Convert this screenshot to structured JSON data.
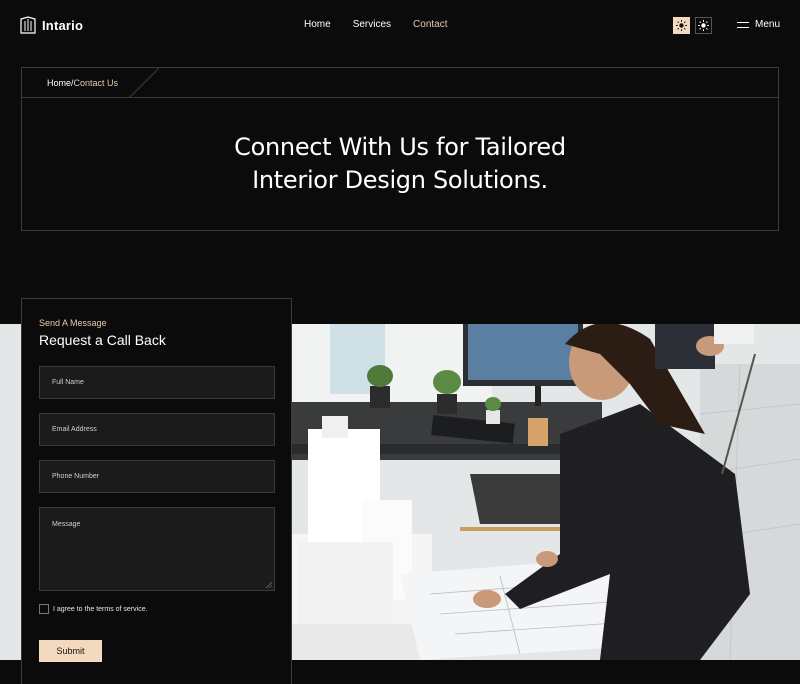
{
  "brand": {
    "name": "Intario",
    "logo_icon": "building-logo-icon"
  },
  "nav": {
    "items": [
      {
        "label": "Home",
        "active": false
      },
      {
        "label": "Services",
        "active": false
      },
      {
        "label": "Contact",
        "active": true
      }
    ]
  },
  "theme_toggle": {
    "light_icon": "sun-icon",
    "dark_icon": "sun-outline-icon"
  },
  "menu": {
    "label": "Menu",
    "icon": "hamburger-icon"
  },
  "breadcrumb": {
    "home": "Home",
    "separator": "/",
    "current": "Contact Us"
  },
  "hero": {
    "title_line1": "Connect With Us for Tailored",
    "title_line2": "Interior Design Solutions."
  },
  "form": {
    "eyebrow": "Send A Message",
    "title": "Request a Call Back",
    "fields": {
      "full_name": "Full Name",
      "email": "Email Address",
      "phone": "Phone Number",
      "message": "Message"
    },
    "terms_label": "I agree to the terms of service.",
    "submit_label": "Submit"
  },
  "colors": {
    "background": "#0b0b0c",
    "accent": "#e7cdb0",
    "button": "#f3d9bd",
    "field_bg": "#1b1b1c",
    "border": "#3c3c3c"
  }
}
